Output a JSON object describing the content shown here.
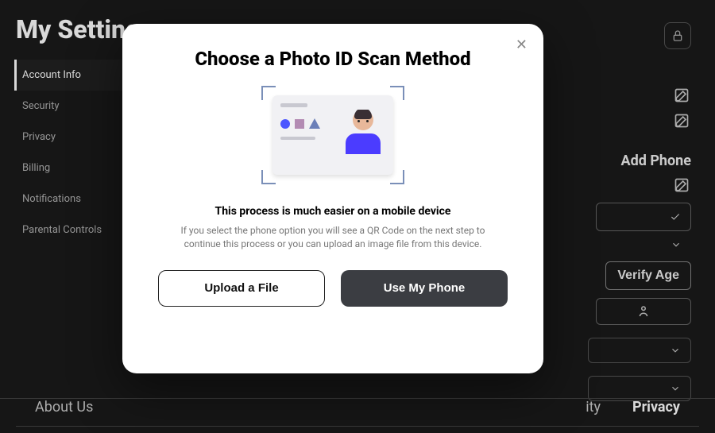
{
  "pageTitle": "My Settings",
  "sidebar": {
    "items": [
      {
        "label": "Account Info",
        "active": true
      },
      {
        "label": "Security"
      },
      {
        "label": "Privacy"
      },
      {
        "label": "Billing"
      },
      {
        "label": "Notifications"
      },
      {
        "label": "Parental Controls"
      }
    ]
  },
  "rightPanel": {
    "addPhoneLabel": "Add Phone",
    "verifyAgeLabel": "Verify Age"
  },
  "footer": {
    "aboutUs": "About Us",
    "accessibilityPartial": "ity",
    "privacy": "Privacy"
  },
  "modal": {
    "title": "Choose a Photo ID Scan Method",
    "subhead": "This process is much easier on a mobile device",
    "description": "If you select the phone option you will see a QR Code on the next step to continue this process or you can upload an image file from this device.",
    "uploadLabel": "Upload a File",
    "phoneLabel": "Use My Phone"
  }
}
